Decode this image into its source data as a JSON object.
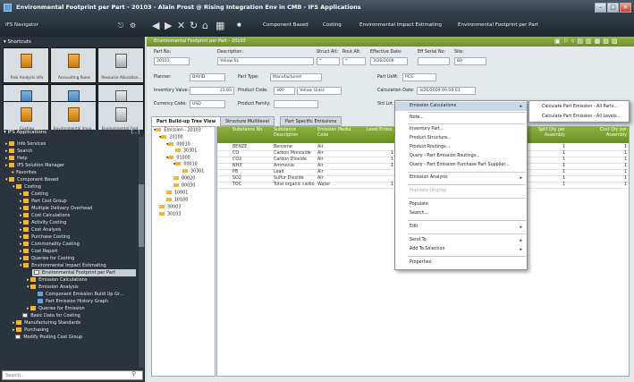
{
  "window": {
    "title": "Environmental Footprint per Part - 20103 - Alain Prost @ Rising Integration Env in CMB - IFS Applications"
  },
  "navigator": {
    "title": "IFS Navigator",
    "shortcuts_label": "Shortcuts",
    "shortcuts": [
      {
        "label": "Risk Analysis Info"
      },
      {
        "label": "Accounting Rules"
      },
      {
        "label": "Resource Allocation..."
      },
      {
        "label": "Overview Customers"
      },
      {
        "label": "Solution and Pre-Int..."
      },
      {
        "label": "Purchase Order"
      },
      {
        "label": "Costing"
      },
      {
        "label": "Environmental Impa..."
      },
      {
        "label": "Environmental Foot..."
      }
    ],
    "applications_label": "IFS Applications",
    "applications_count": "[...]",
    "tree": [
      {
        "label": "Info Services"
      },
      {
        "label": "Search"
      },
      {
        "label": "Help"
      },
      {
        "label": "IFS Solution Manager"
      },
      {
        "label": "Favorites"
      },
      {
        "label": "Component Based"
      },
      {
        "label": "Costing"
      },
      {
        "label": "Costing"
      },
      {
        "label": "Part Cost Group"
      },
      {
        "label": "Multiple Delivery Overhead"
      },
      {
        "label": "Cost Calculations"
      },
      {
        "label": "Activity Costing"
      },
      {
        "label": "Cost Analysis"
      },
      {
        "label": "Purchase Costing"
      },
      {
        "label": "Commonality Costing"
      },
      {
        "label": "Cost Report"
      },
      {
        "label": "Queries for Costing"
      },
      {
        "label": "Environmental Impact Estimating"
      },
      {
        "label": "Environmental Footprint per Part"
      },
      {
        "label": "Emission Calculations"
      },
      {
        "label": "Emission Analysis"
      },
      {
        "label": "Component Emission Build Up Gr..."
      },
      {
        "label": "Part Emission History Graph"
      },
      {
        "label": "Queries for Emission"
      },
      {
        "label": "Basic Data for Costing"
      },
      {
        "label": "Manufacturing Standards"
      },
      {
        "label": "Purchasing"
      },
      {
        "label": "Modify Posting Cost Group"
      }
    ],
    "search_placeholder": "Search..."
  },
  "tabs": {
    "component_based": "Component Based",
    "costing": "Costing",
    "environmental_impact": "Environmental Impact Estimating",
    "environmental_footprint": "Environmental Footprint per Part"
  },
  "page": {
    "title": "Environmental Footprint per Part - 20103",
    "fields": {
      "part_no_label": "Part No:",
      "part_no": "20103",
      "description_label": "Description:",
      "description": "Yellow SL",
      "struct_alt_label": "Struct Alt:",
      "struct_alt": "*",
      "rout_alt_label": "Rout Alt:",
      "rout_alt": "*",
      "effective_date_label": "Effective Date:",
      "effective_date": "3/26/2009",
      "eff_serial_label": "Eff Serial No:",
      "eff_serial": "",
      "site_label": "Site:",
      "site": "80",
      "planner_label": "Planner:",
      "planner": "DAVID",
      "part_type_label": "Part Type:",
      "part_type": "Manufactured",
      "part_uom_label": "Part UoM:",
      "part_uom": "PCS",
      "inventory_value_label": "Inventory Value:",
      "inventory_value": "23.60",
      "product_code_label": "Product Code:",
      "product_code": "300",
      "product_code_desc": "Yellow Glass",
      "calc_date_label": "Calculation Date:",
      "calc_date": "3/26/2009 09:59:01",
      "currency_label": "Currency Code:",
      "currency": "USD",
      "product_family_label": "Product Family:",
      "product_family": "",
      "std_lot_label": "Std Lot"
    },
    "subtabs": [
      "Part Build-up Tree View",
      "Structure Multilevel",
      "Part Specific Emissions"
    ],
    "tree": [
      {
        "label": "Emission - 20103"
      },
      {
        "label": "20100"
      },
      {
        "label": "00010"
      },
      {
        "label": "30301"
      },
      {
        "label": "01000"
      },
      {
        "label": "00010"
      },
      {
        "label": "30301"
      },
      {
        "label": "00020"
      },
      {
        "label": "00030"
      },
      {
        "label": "10001"
      },
      {
        "label": "10100"
      },
      {
        "label": "30003"
      },
      {
        "label": "30103"
      }
    ],
    "grid": {
      "headers": [
        "Substance No.",
        "Substance Description",
        "Emission Media Code",
        "Level Emiss...",
        "Split Qty per Assembly",
        "Cost Qty per Assembly"
      ],
      "rows": [
        {
          "no": "BENZE",
          "desc": "Benzene",
          "media": "Air",
          "level": "",
          "split": "1",
          "cost": "1"
        },
        {
          "no": "CO",
          "desc": "Carbon Monoxide",
          "media": "Air",
          "level": "1",
          "split": "1",
          "cost": "1"
        },
        {
          "no": "CO2",
          "desc": "Carbon Dioxide",
          "media": "Air",
          "level": "1",
          "split": "1",
          "cost": "1"
        },
        {
          "no": "NH3",
          "desc": "Ammonia",
          "media": "Air",
          "level": "1",
          "split": "1",
          "cost": "1"
        },
        {
          "no": "PB",
          "desc": "Lead",
          "media": "Air",
          "level": "",
          "split": "1",
          "cost": "1"
        },
        {
          "no": "SO2",
          "desc": "Sulfur Dioxide",
          "media": "Air",
          "level": "",
          "split": "1",
          "cost": "1"
        },
        {
          "no": "TOC",
          "desc": "Total organic carbo",
          "media": "Water",
          "level": "1",
          "split": "1",
          "cost": "1"
        }
      ]
    }
  },
  "context_menu": {
    "items": [
      {
        "label": "Emission Calculations",
        "arrow": "▸"
      },
      {
        "label": "Note..."
      },
      {
        "label": "Inventory Part..."
      },
      {
        "label": "Product Structure..."
      },
      {
        "label": "Product Routings..."
      },
      {
        "label": "Query - Part Emission Routings..."
      },
      {
        "label": "Query - Part Emission Purchase Part Supplier..."
      },
      {
        "label": "Emission Analysis",
        "arrow": "▸"
      },
      {
        "label": "Populate Original"
      },
      {
        "label": "Populate"
      },
      {
        "label": "Search..."
      },
      {
        "label": "Edit",
        "arrow": "▸"
      },
      {
        "label": "Send To",
        "arrow": "▸"
      },
      {
        "label": "Add To Selection",
        "arrow": "▸"
      },
      {
        "label": "Properties"
      }
    ],
    "submenu": [
      {
        "label": "Calculate Part Emission - All Parts..."
      },
      {
        "label": "Calculate Part Emission - All Levels..."
      }
    ]
  },
  "colors": {
    "accent_green": "#7a9e2e",
    "dark_nav": "#2b343c"
  },
  "icons": [
    "back-icon",
    "forward-icon",
    "close-icon",
    "refresh-icon",
    "home-icon",
    "grid-icon",
    "folder-icon"
  ]
}
